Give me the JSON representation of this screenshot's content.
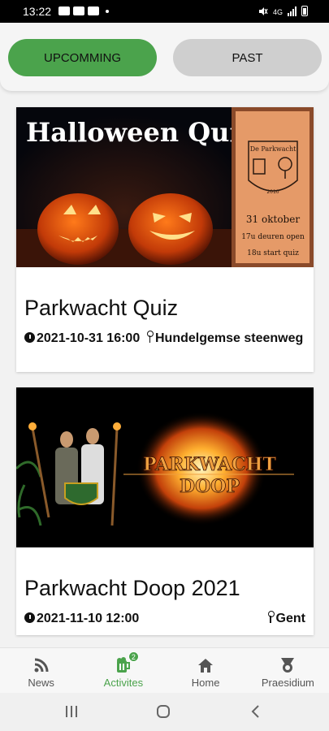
{
  "status_bar": {
    "time": "13:22",
    "network": "4G"
  },
  "tabs": [
    {
      "label": "UPCOMMING",
      "active": true
    },
    {
      "label": "PAST",
      "active": false
    }
  ],
  "events": [
    {
      "title": "Parkwacht Quiz",
      "datetime": "2021-10-31 16:00",
      "location": "Hundelgemse steenweg",
      "image": {
        "headline": "Halloween Quiz",
        "crest_name": "De Parkwacht",
        "crest_year": "2010",
        "date_line": "31 oktober",
        "doors_line": "17u deuren open",
        "start_line": "18u start quiz"
      }
    },
    {
      "title": "Parkwacht Doop 2021",
      "datetime": "2021-11-10 12:00",
      "location": "Gent",
      "image": {
        "line1": "PARKWACHT",
        "line2": "DOOP"
      }
    }
  ],
  "bottom_nav": [
    {
      "label": "News",
      "icon": "rss-icon"
    },
    {
      "label": "Activites",
      "icon": "beer-icon",
      "badge": "2",
      "active": true
    },
    {
      "label": "Home",
      "icon": "home-icon"
    },
    {
      "label": "Praesidium",
      "icon": "medal-icon"
    }
  ],
  "colors": {
    "accent": "#4ba34c",
    "tab_inactive": "#cfcfcf"
  }
}
